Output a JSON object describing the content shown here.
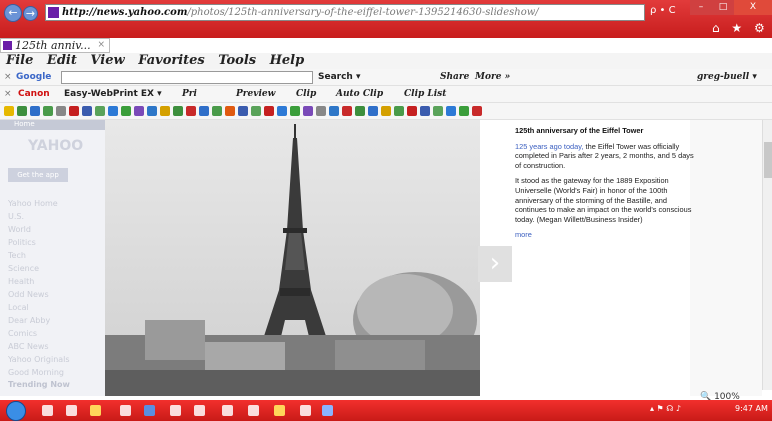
{
  "browser": {
    "address": "http://news.yahoo.com/photos/125th-anniversary-of-the-eiffel-tower-1395214630-slideshow/",
    "address_host": "http://news.yahoo.com",
    "address_path": "/photos/125th-anniversary-of-the-eiffel-tower-1395214630-slideshow/",
    "address_tools": "ρ • C",
    "tab_title": "125th anniv...",
    "tab_close": "×",
    "win_min": "–",
    "win_max": "□",
    "win_close": "X",
    "top_icons": "⌂ ★ ⚙"
  },
  "menu": [
    "File",
    "Edit",
    "View",
    "Favorites",
    "Tools",
    "Help"
  ],
  "toolbar_google": {
    "close": "×",
    "logo": "Google",
    "search": "Search ▾",
    "share": "Share",
    "more": "More »",
    "user": "greg-buell ▾"
  },
  "toolbar_canon": {
    "close": "×",
    "canon": "Canon",
    "webprint": "Easy-WebPrint EX ▾",
    "print": "Pri",
    "preview": "Preview",
    "clip": "Clip",
    "autoclip": "Auto Clip",
    "cliplist": "Clip List"
  },
  "sidebar": {
    "home": "Home",
    "logo": "YAHOO",
    "mail": "Get the app",
    "nav": [
      "Yahoo Home",
      "U.S.",
      "World",
      "Politics",
      "Tech",
      "Science",
      "Health",
      "Odd News",
      "Local",
      "Dear Abby",
      "Comics",
      "ABC News",
      "Yahoo Originals",
      "Good Morning"
    ],
    "trending": "Trending Now"
  },
  "caption": {
    "title": "125th anniversary of the Eiffel Tower",
    "link_text": "125 years ago today,",
    "p1_rest": " the Eiffel Tower was officially completed in Paris after 2 years, 2 months, and 5 days of construction.",
    "p2": "It stood as the gateway for the 1889 Exposition Universelle (World's Fair) in honor of the 100th anniversary of the storming of the Bastille, and continues to make an impact on the world's conscious today. (Megan Willett/Business Insider)",
    "more": "more"
  },
  "status": {
    "zoom": "100%"
  },
  "taskbar": {
    "tray": "▴ ⚑ ☊ ♪",
    "time": "9:47 AM"
  }
}
